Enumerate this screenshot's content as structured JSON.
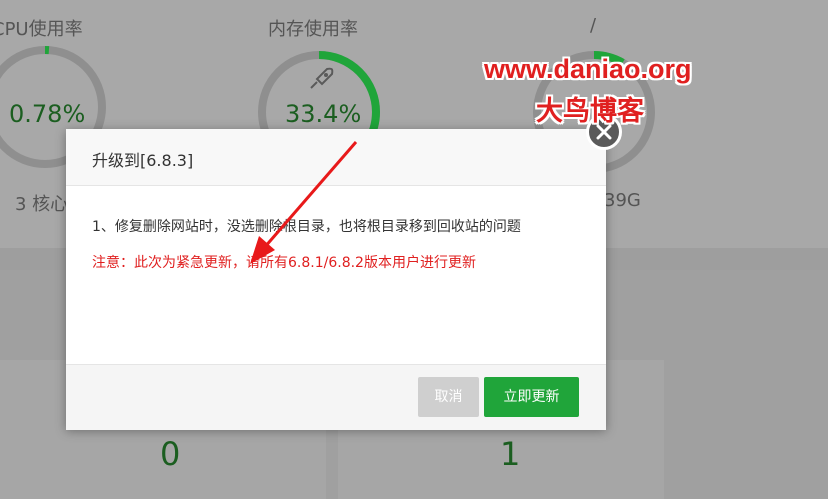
{
  "gauges": [
    {
      "title": "CPU使用率",
      "value": "0.78%",
      "sub": "3 核心",
      "percent": 0.78,
      "color": "#20a53a"
    },
    {
      "title": "内存使用率",
      "value": "33.4%",
      "sub": "",
      "percent": 33.4,
      "color": "#20a53a",
      "icon": "rocket-icon"
    },
    {
      "title": "/",
      "value": "",
      "sub": "39G",
      "percent": 8,
      "color": "#20a53a"
    }
  ],
  "counts": [
    "0",
    "1"
  ],
  "watermark": {
    "url": "www.daniao.org",
    "name": "大鸟博客"
  },
  "dialog": {
    "title": "升级到[6.8.3]",
    "line1": "1、修复删除网站时，没选删除根目录，也将根目录移到回收站的问题",
    "warning": "注意：此次为紧急更新，请所有6.8.1/6.8.2版本用户进行更新",
    "cancel_label": "取消",
    "update_label": "立即更新"
  },
  "colors": {
    "accent": "#20a53a",
    "warning": "#e02020",
    "annotation": "#e8191a"
  }
}
